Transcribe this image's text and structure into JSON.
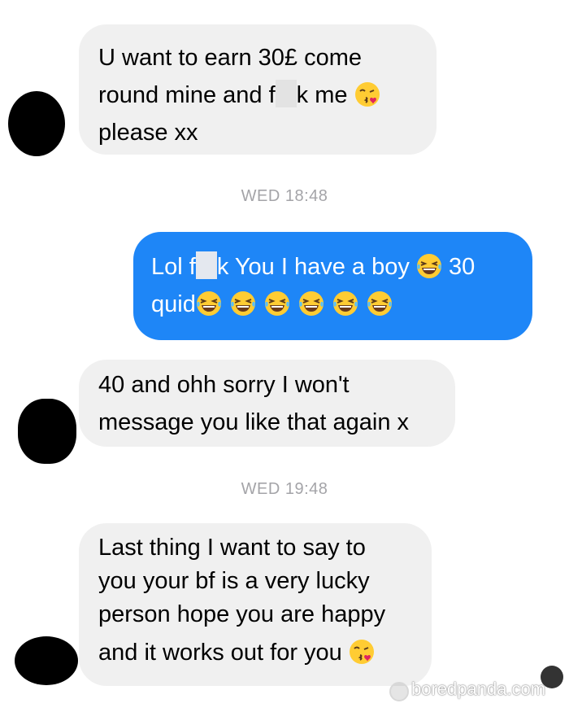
{
  "messages": [
    {
      "lines": [
        "U want to earn 30£ come",
        "round mine and f",
        "please xx"
      ],
      "seg2": "k me"
    },
    {
      "lines": [
        "Lol f",
        "quid"
      ],
      "seg1": "k You I have a boy",
      "num": "30"
    },
    {
      "lines": [
        "40 and ohh sorry I won't",
        "message you like that again x"
      ]
    },
    {
      "lines": [
        "Last thing I want to say to",
        "you your bf is a very lucky",
        "person hope you are happy",
        "and it works out for you"
      ]
    }
  ],
  "timestamps": [
    "WED 18:48",
    "WED 19:48"
  ],
  "watermark": "boredpanda.com",
  "icons": [
    "kiss-emoji-icon",
    "laughing-emoji-icon",
    "bored-panda-logo-icon"
  ],
  "colors": {
    "incoming_bubble": "#f0f0f0",
    "outgoing_bubble": "#1e86f7",
    "timestamp": "#a4a4a8"
  }
}
